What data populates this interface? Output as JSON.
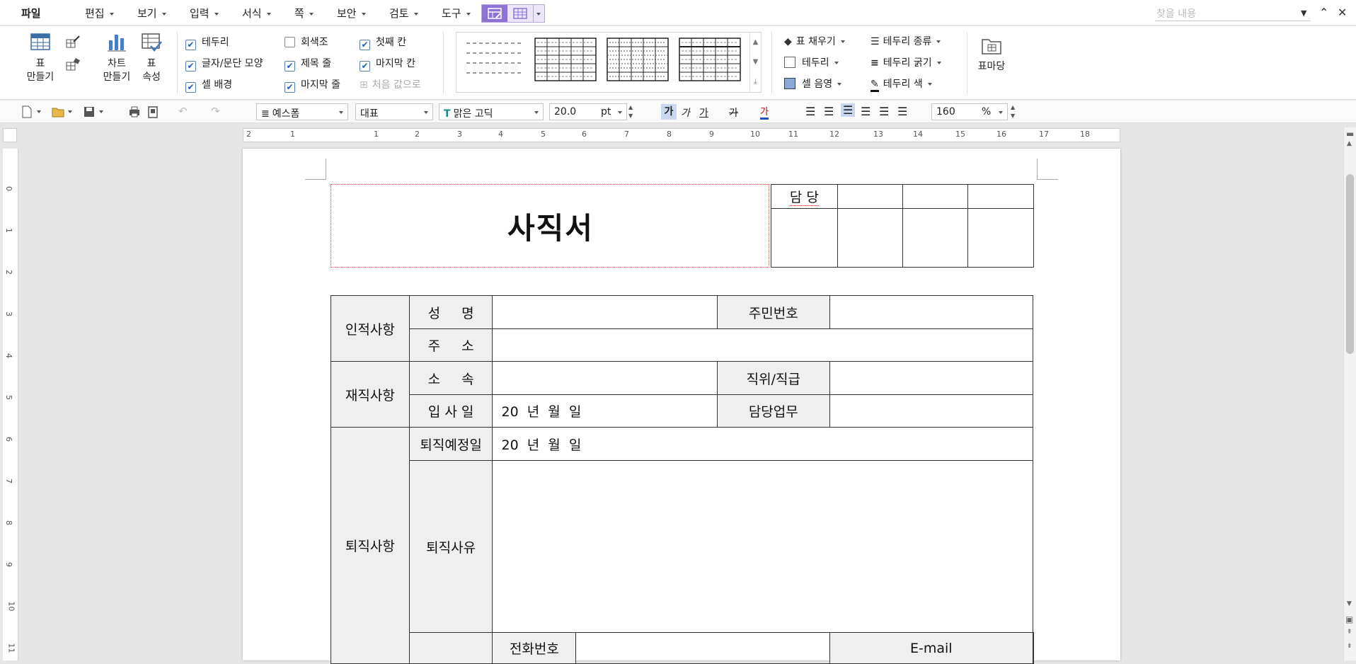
{
  "menu": {
    "file": "파일",
    "items": [
      "편집",
      "보기",
      "입력",
      "서식",
      "쪽",
      "보안",
      "검토",
      "도구"
    ],
    "find_placeholder": "찾을 내용"
  },
  "ribbon": {
    "make_table": "표\n만들기",
    "make_chart": "차트\n만들기",
    "table_props": "표\n속성",
    "checks": [
      {
        "label": "테두리",
        "checked": true,
        "enabled": true
      },
      {
        "label": "글자/문단 모양",
        "checked": true,
        "enabled": true
      },
      {
        "label": "셀 배경",
        "checked": true,
        "enabled": true
      },
      {
        "label": "회색조",
        "checked": false,
        "enabled": true
      },
      {
        "label": "제목 줄",
        "checked": true,
        "enabled": true
      },
      {
        "label": "마지막 줄",
        "checked": true,
        "enabled": true
      },
      {
        "label": "첫째 칸",
        "checked": true,
        "enabled": true
      },
      {
        "label": "마지막 칸",
        "checked": true,
        "enabled": true
      },
      {
        "label": "처음 값으로",
        "checked": false,
        "enabled": false
      }
    ],
    "fill": "표 채우기",
    "border": "테두리",
    "cell_shade": "셀 음영",
    "border_type": "테두리 종류",
    "border_weight": "테두리 굵기",
    "border_color": "테두리 색",
    "table_macro": "표마당"
  },
  "toolbar": {
    "style": "예스폼",
    "style2": "대표",
    "font": "맑은 고딕",
    "size": "20.0",
    "unit": "pt",
    "zoom": "160",
    "zoom_unit": "%",
    "font_glyph": "가",
    "italic_glyph": "가",
    "underline_glyph": "가",
    "strike_glyph": "가",
    "color_glyph": "가"
  },
  "ruler": {
    "h": [
      "2",
      "1",
      "1",
      "2",
      "3",
      "4",
      "5",
      "6",
      "7",
      "8",
      "9",
      "10",
      "11",
      "12",
      "13",
      "14",
      "15",
      "16",
      "17",
      "18"
    ],
    "v": [
      "0",
      "1",
      "2",
      "3",
      "4",
      "5",
      "6",
      "7",
      "8",
      "9",
      "10",
      "11"
    ]
  },
  "doc": {
    "title": "사직서",
    "approval": "담 당",
    "personal": "인적사항",
    "name": "성 명",
    "ssn": "주민번호",
    "address": "주 소",
    "employment": "재직사항",
    "dept": "소 속",
    "position": "직위/직급",
    "join_date": "입 사 일",
    "date_fmt": "20  년  월  일",
    "duty": "담당업무",
    "retirement": "퇴직사항",
    "planned_date": "퇴직예정일",
    "date_fmt2": "20  년  월  일",
    "reason": "퇴직사유",
    "phone": "전화번호",
    "email": "E-mail"
  }
}
